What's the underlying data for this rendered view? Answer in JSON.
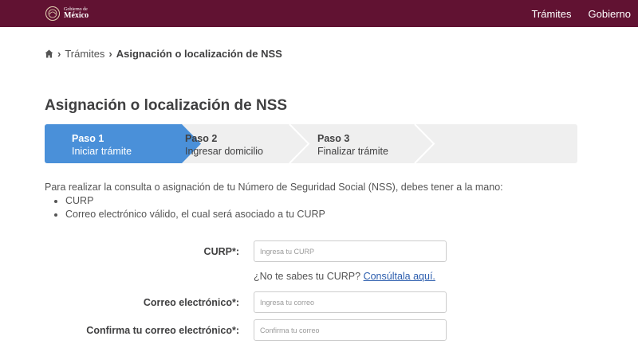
{
  "header": {
    "logo_small": "Gobierno de",
    "logo_big": "México",
    "nav": [
      "Trámites",
      "Gobierno"
    ]
  },
  "breadcrumb": {
    "link": "Trámites",
    "current": "Asignación o localización de NSS"
  },
  "page": {
    "title": "Asignación o localización de NSS"
  },
  "stepper": {
    "steps": [
      {
        "title": "Paso 1",
        "subtitle": "Iniciar trámite",
        "active": true
      },
      {
        "title": "Paso 2",
        "subtitle": "Ingresar domicilio",
        "active": false
      },
      {
        "title": "Paso 3",
        "subtitle": "Finalizar trámite",
        "active": false
      }
    ],
    "active_color": "#4a90d9"
  },
  "intro": {
    "text": "Para realizar la consulta o asignación de tu Número de Seguridad Social (NSS), debes tener a la mano:",
    "items": [
      "CURP",
      "Correo electrónico válido, el cual será asociado a tu CURP"
    ]
  },
  "form": {
    "curp_label": "CURP*:",
    "curp_placeholder": "Ingresa tu CURP",
    "help_text": "¿No te sabes tu CURP? ",
    "help_link": "Consúltala aquí.",
    "email_label": "Correo electrónico*:",
    "email_placeholder": "Ingresa tu correo",
    "confirm_label": "Confirma tu correo electrónico*:",
    "confirm_placeholder": "Confirma tu correo"
  },
  "colors": {
    "header_bg": "#611232",
    "link": "#2a5cad"
  }
}
